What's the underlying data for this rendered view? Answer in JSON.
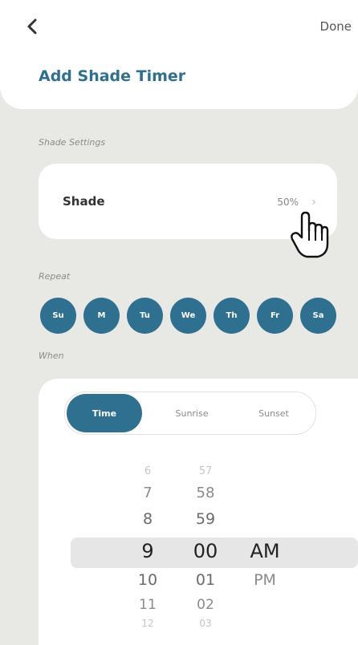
{
  "header": {
    "done_label": "Done",
    "title": "Add Shade Timer",
    "back_icon": "chevron-left-icon"
  },
  "shade_settings": {
    "section_label": "Shade Settings",
    "label": "Shade",
    "value": "50%",
    "chevron_icon": "chevron-right-icon"
  },
  "repeat": {
    "section_label": "Repeat",
    "days": [
      "Su",
      "M",
      "Tu",
      "We",
      "Th",
      "Fr",
      "Sa"
    ]
  },
  "when": {
    "section_label": "When",
    "tabs": [
      "Time",
      "Sunrise",
      "Sunset"
    ],
    "selected_tab": "Time",
    "picker": {
      "hours": [
        "6",
        "7",
        "8",
        "9",
        "10",
        "11",
        "12"
      ],
      "minutes": [
        "57",
        "58",
        "59",
        "00",
        "01",
        "02",
        "03"
      ],
      "periods": [
        "AM",
        "PM"
      ],
      "selected": {
        "hour": "9",
        "minute": "00",
        "period": "AM"
      }
    }
  },
  "colors": {
    "accent": "#2f6f8f",
    "background": "#e8e8e4",
    "card": "#ffffff"
  }
}
